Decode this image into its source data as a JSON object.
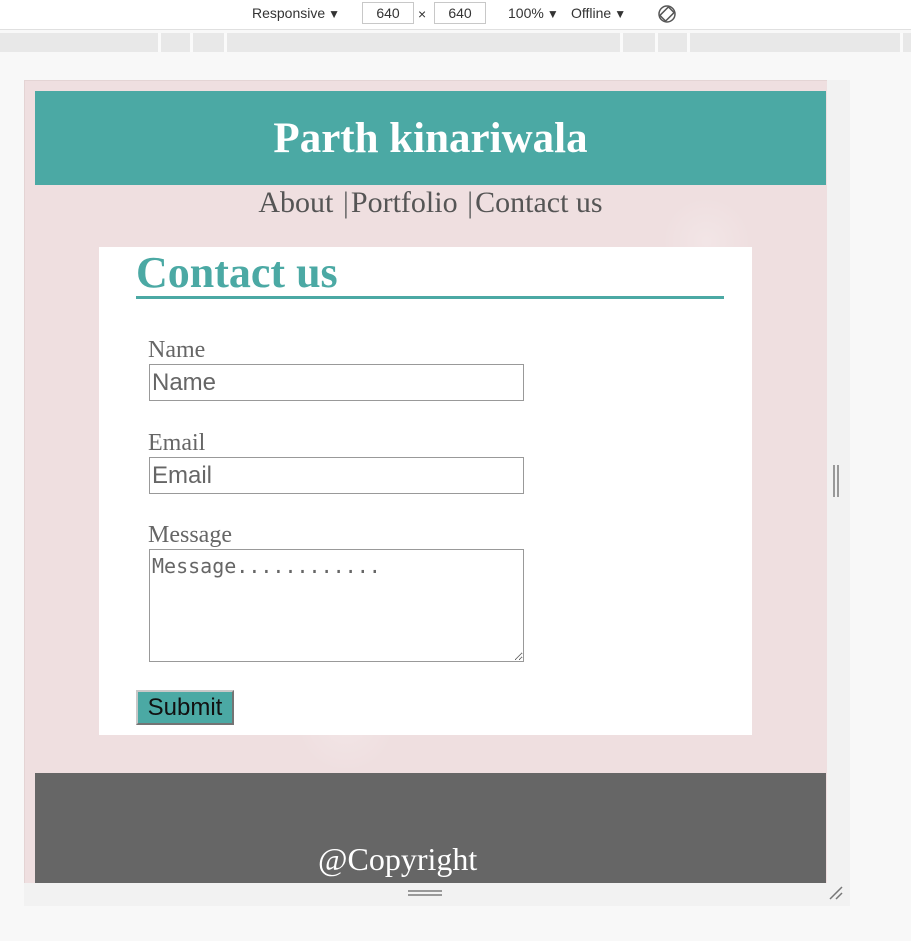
{
  "devtools": {
    "device_label": "Responsive",
    "width_value": "640",
    "times_sign": "×",
    "height_value": "640",
    "zoom_label": "100%",
    "network_label": "Offline",
    "dropdown_arrow": "▼"
  },
  "header": {
    "title": "Parth kinariwala"
  },
  "nav": {
    "items": [
      {
        "label": "About"
      },
      {
        "label": "Portfolio"
      },
      {
        "label": "Contact us"
      }
    ],
    "separator": "|"
  },
  "contact": {
    "heading": "Contact us",
    "name_label": "Name",
    "name_placeholder": "Name",
    "email_label": "Email",
    "email_placeholder": "Email",
    "message_label": "Message",
    "message_placeholder": "Message............",
    "submit_label": "Submit"
  },
  "footer": {
    "text": "@Copyright"
  },
  "colors": {
    "accent": "#4ba9a4",
    "footer_bg": "#666666",
    "page_bg": "#efdfe0"
  }
}
